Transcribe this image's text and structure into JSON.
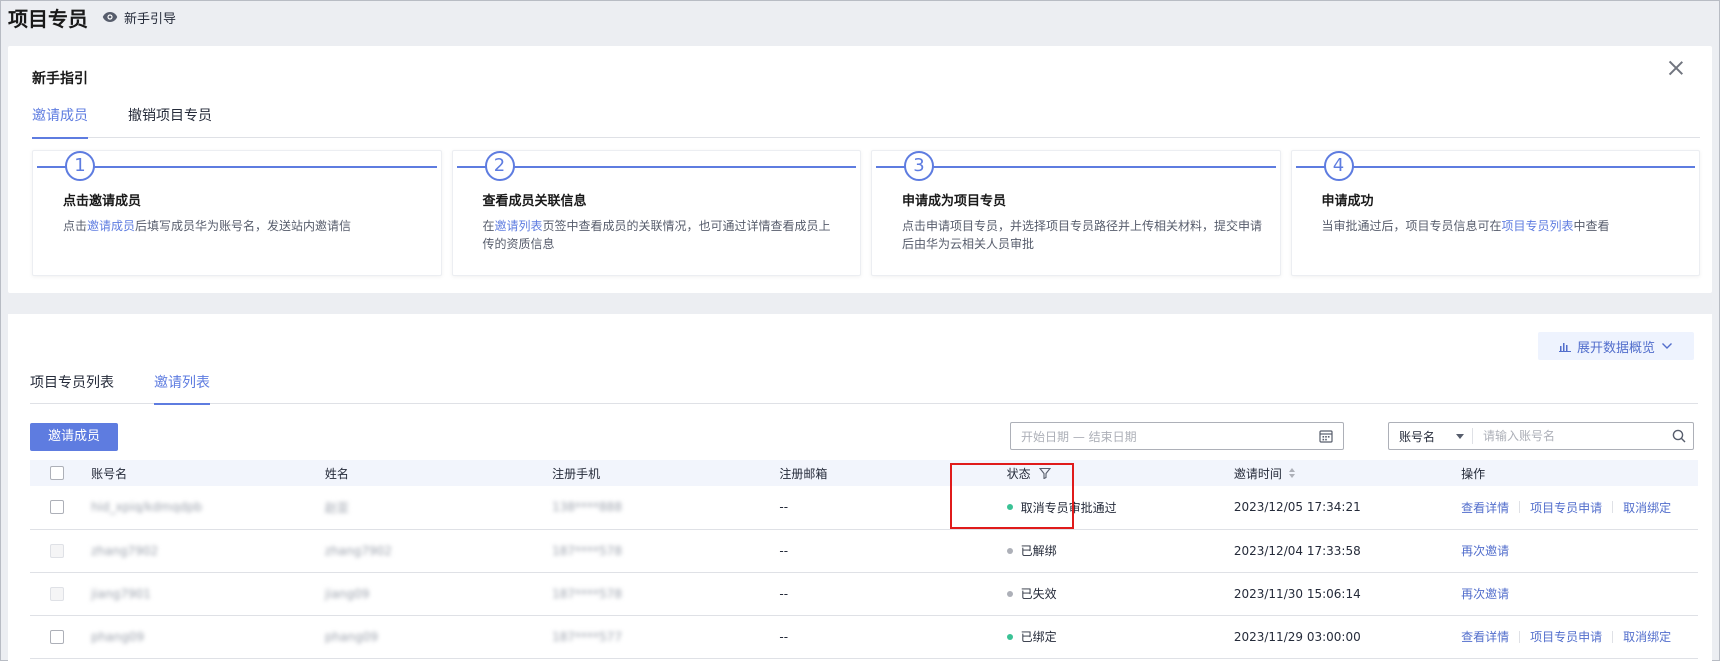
{
  "header": {
    "title": "项目专员",
    "guide_label": "新手引导"
  },
  "guide": {
    "title": "新手指引",
    "tabs": [
      "邀请成员",
      "撤销项目专员"
    ],
    "steps": [
      {
        "num": "1",
        "title": "点击邀请成员",
        "desc_pre": "点击",
        "desc_link": "邀请成员",
        "desc_post": "后填写成员华为账号名，发送站内邀请信"
      },
      {
        "num": "2",
        "title": "查看成员关联信息",
        "desc_pre": "在",
        "desc_link": "邀请列表",
        "desc_post": "页签中查看成员的关联情况，也可通过详情查看成员上传的资质信息"
      },
      {
        "num": "3",
        "title": "申请成为项目专员",
        "desc_pre": "点击申请项目专员，并选择项目专员路径并上传相关材料，提交申请后由华为云相关人员审批",
        "desc_link": "",
        "desc_post": ""
      },
      {
        "num": "4",
        "title": "申请成功",
        "desc_pre": "当审批通过后，项目专员信息可在",
        "desc_link": "项目专员列表",
        "desc_post": "中查看"
      }
    ]
  },
  "list": {
    "overview_label": "展开数据概览",
    "tabs": [
      "项目专员列表",
      "邀请列表"
    ],
    "invite_button": "邀请成员",
    "date_placeholder": "开始日期 — 结束日期",
    "search_select": "账号名",
    "search_placeholder": "请输入账号名",
    "columns": [
      "账号名",
      "姓名",
      "注册手机",
      "注册邮箱",
      "状态",
      "邀请时间",
      "操作"
    ],
    "rows": [
      {
        "account": "hid_xpiq/kdmqdpb",
        "name": "赵亚",
        "phone": "138****888",
        "email": "--",
        "status": "取消专员审批通过",
        "status_color": "#3ac295",
        "time": "2023/12/05 17:34:21",
        "ops": [
          "查看详情",
          "项目专员申请",
          "取消绑定"
        ]
      },
      {
        "account": "zhang7902",
        "name": "zhang7902",
        "phone": "187****578",
        "email": "--",
        "status": "已解绑",
        "status_color": "#adb0b8",
        "time": "2023/12/04 17:33:58",
        "ops": [
          "再次邀请"
        ]
      },
      {
        "account": "jiang7901",
        "name": "jiang09",
        "phone": "187****578",
        "email": "--",
        "status": "已失效",
        "status_color": "#adb0b8",
        "time": "2023/11/30 15:06:14",
        "ops": [
          "再次邀请"
        ]
      },
      {
        "account": "phang09",
        "name": "phang09",
        "phone": "187****577",
        "email": "--",
        "status": "已绑定",
        "status_color": "#3ac295",
        "time": "2023/11/29 03:00:00",
        "ops": [
          "查看详情",
          "项目专员申请",
          "取消绑定"
        ]
      }
    ]
  }
}
